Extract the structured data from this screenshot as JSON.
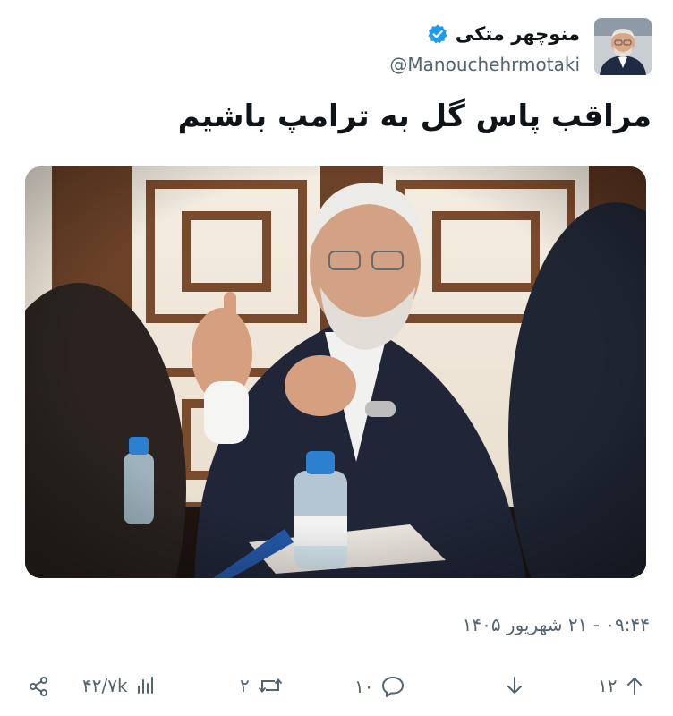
{
  "author": {
    "display_name": "منوچهر متکی",
    "handle": "@Manouchehrmotaki",
    "verified": true,
    "avatar_icon": "profile-photo"
  },
  "tweet": {
    "text": "مراقب پاس گل به ترامپ باشیم",
    "media_description_icon": "photo",
    "timestamp": "۰۹:۴۴ - ۲۱ شهریور ۱۴۰۵"
  },
  "actions": {
    "views_count": "۴۲/۷k",
    "retweet_count": "۲",
    "reply_count": "۱۰",
    "upvote_count": "۱۲"
  },
  "colors": {
    "text_primary": "#0f1419",
    "text_secondary": "#536471",
    "verified_blue": "#1d9bf0"
  }
}
